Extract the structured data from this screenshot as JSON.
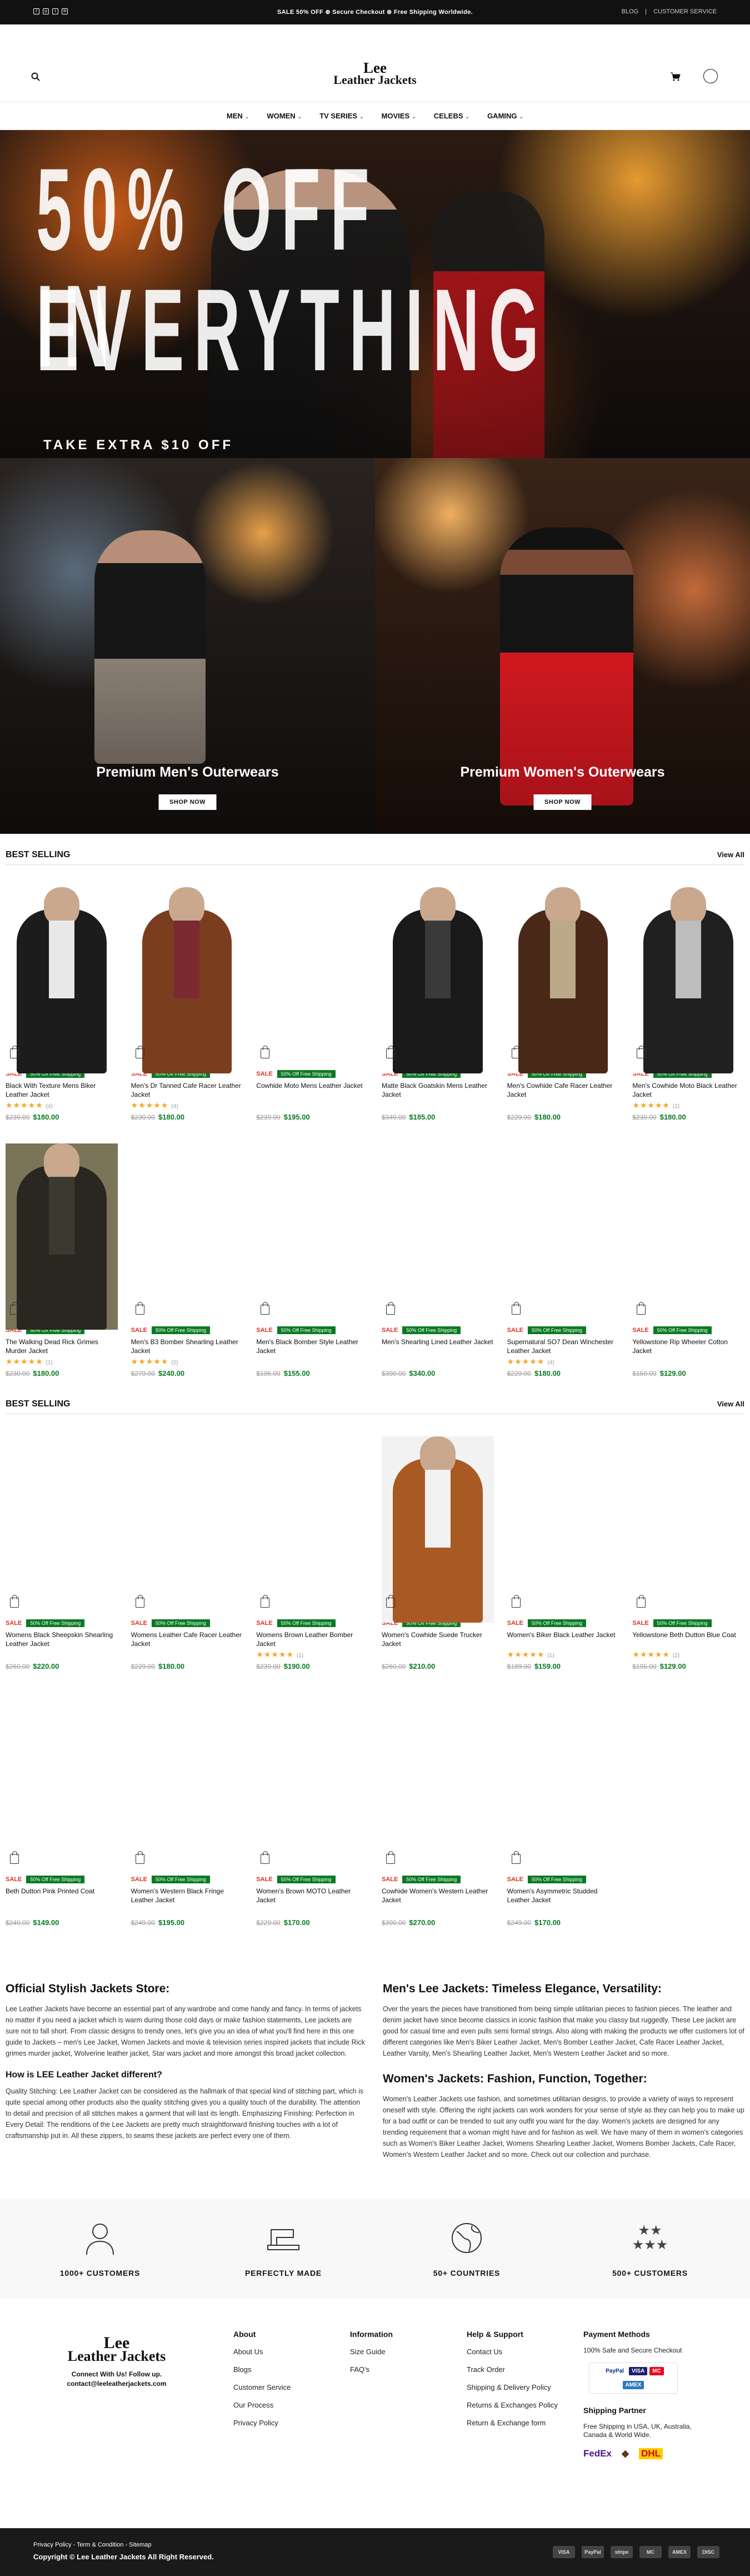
{
  "topbar": {
    "promo": "SALE 50% OFF ⊕ Secure Checkout ⊕ Free Shipping Worldwide.",
    "links": [
      "BLOG",
      "|",
      "CUSTOMER SERVICE"
    ]
  },
  "header": {
    "logo_line1": "Lee",
    "logo_line2": "Leather Jackets"
  },
  "nav": [
    "MEN",
    "WOMEN",
    "TV SERIES",
    "MOVIES",
    "CELEBS",
    "GAMING"
  ],
  "hero": {
    "line1": "50% OFF IN",
    "line2": "EVERYTHING",
    "sub": "TAKE EXTRA $10 OFF"
  },
  "promos": [
    {
      "title": "Premium Men's Outerwears",
      "button": "SHOP NOW"
    },
    {
      "title": "Premium Women's Outerwears",
      "button": "SHOP NOW"
    }
  ],
  "section1": {
    "title": "BEST SELLING",
    "view_all": "View All"
  },
  "section2": {
    "title": "BEST SELLING",
    "view_all": "View All"
  },
  "labels": {
    "sale": "SALE",
    "ship": "50% Off Free Shipping"
  },
  "products1": [
    {
      "name": "Black With Texture Mens Biker Leather Jacket",
      "stars": "★★★★★",
      "count": "(4)",
      "old": "$239.00",
      "new": "$180.00"
    },
    {
      "name": "Men's Dr Tanned Cafe Racer Leather Jacket",
      "stars": "★★★★★",
      "count": "(4)",
      "old": "$230.00",
      "new": "$180.00"
    },
    {
      "name": "Cowhide Moto Mens Leather Jacket",
      "stars": "",
      "count": "",
      "old": "$239.00",
      "new": "$195.00"
    },
    {
      "name": "Matte Black Goatskin Mens Leather Jacket",
      "stars": "",
      "count": "",
      "old": "$349.00",
      "new": "$185.00"
    },
    {
      "name": "Men's Cowhide Cafe Racer Leather Jacket",
      "stars": "",
      "count": "",
      "old": "$229.00",
      "new": "$180.00"
    },
    {
      "name": "Men's Cowhide Moto Black Leather Jacket",
      "stars": "★★★★★",
      "count": "(1)",
      "old": "$230.00",
      "new": "$180.00"
    },
    {
      "name": "The Walking Dead Rick Grimes Murder Jacket",
      "stars": "★★★★★",
      "count": "(1)",
      "old": "$230.00",
      "new": "$180.00"
    },
    {
      "name": "Men's B3 Bomber Shearling Leather Jacket",
      "stars": "★★★★★",
      "count": "(2)",
      "old": "$279.00",
      "new": "$240.00"
    },
    {
      "name": "Men's Black Bomber Style Leather Jacket",
      "stars": "",
      "count": "",
      "old": "$195.00",
      "new": "$155.00"
    },
    {
      "name": "Men's Shearling Lined Leather Jacket",
      "stars": "",
      "count": "",
      "old": "$390.00",
      "new": "$340.00"
    },
    {
      "name": "Supernatural SO7 Dean Winchester Leather Jacket",
      "stars": "★★★★★",
      "count": "(4)",
      "old": "$229.00",
      "new": "$180.00"
    },
    {
      "name": "Yellowstone Rip Wheeler Cotton Jacket",
      "stars": "",
      "count": "",
      "old": "$150.00",
      "new": "$129.00"
    }
  ],
  "products2": [
    {
      "name": "Womens Black Sheepskin Shearling Leather Jacket",
      "stars": "",
      "count": "",
      "old": "$260.00",
      "new": "$220.00"
    },
    {
      "name": "Womens Leather Cafe Racer Leather Jacket",
      "stars": "",
      "count": "",
      "old": "$229.00",
      "new": "$180.00"
    },
    {
      "name": "Womens Brown Leather Bomber Jacket",
      "stars": "★★★★★",
      "count": "(1)",
      "old": "$239.00",
      "new": "$190.00"
    },
    {
      "name": "Women's Cowhide Suede Trucker Jacket",
      "stars": "",
      "count": "",
      "old": "$260.00",
      "new": "$210.00"
    },
    {
      "name": "Women's Biker Black Leather Jacket",
      "stars": "★★★★★",
      "count": "(1)",
      "old": "$189.00",
      "new": "$159.00"
    },
    {
      "name": "Yellowstone Beth Dutton Blue Coat",
      "stars": "★★★★★",
      "count": "(2)",
      "old": "$195.00",
      "new": "$129.00"
    },
    {
      "name": "Beth Dutton Pink Printed Coat",
      "stars": "",
      "count": "",
      "old": "$240.00",
      "new": "$149.00"
    },
    {
      "name": "Women's Western Black Fringe Leather Jacket",
      "stars": "",
      "count": "",
      "old": "$249.00",
      "new": "$195.00"
    },
    {
      "name": "Women's Brown MOTO Leather Jacket",
      "stars": "",
      "count": "",
      "old": "$229.00",
      "new": "$170.00"
    },
    {
      "name": "Cowhide Women's Western Leather Jacket",
      "stars": "",
      "count": "",
      "old": "$390.00",
      "new": "$270.00"
    },
    {
      "name": "Women's Asymmetric Studded Leather Jacket",
      "stars": "",
      "count": "",
      "old": "$249.00",
      "new": "$170.00"
    }
  ],
  "seo": {
    "left_h": "Official Stylish Jackets Store:",
    "left_p": "Lee Leather Jackets have become an essential part of any wardrobe and come handy and fancy. In terms of jackets no matter if you need a jacket which is warm during those cold days or make fashion statements, Lee jackets are sure not to fall short. From classic designs to trendy ones, let's give you an idea of what you'll find here in this one guide to Jackets – men's Lee Jacket, Women Jackets and movie & television series inspired jackets that include Rick grimes murder jacket, Wolverine leather jacket, Star wars jacket and more amongst this broad jacket collection.",
    "left_h2": "How is LEE Leather Jacket different?",
    "left_p2": "Quality Stitching: Lee Leather Jacket can be considered as the hallmark of that special kind of stitching part, which is quite special among other products also the quality stitching gives you a quality touch of the durability. The attention to detail and precision of all stitches makes a garment that will last its length. Emphasizing Finishing: Perfection in Every Detail: The renditions of the Lee Jackets are pretty much straightforward finishing touches with a lot of craftsmanship put in. All these zippers, to seams these jackets are perfect every one of them.",
    "right_h": "Men's Lee Jackets: Timeless Elegance, Versatility:",
    "right_p": "Over the years the pieces have transitioned from being simple utilitarian pieces to fashion pieces. The leather and denim jacket have since become classics in iconic fashion that make you classy but ruggedly. These Lee jacket are good for casual time and even pulls semi formal strings. Also along with making the products we offer customers lot of different categories like Men's Biker Leather Jacket, Men's Bomber Leather Jacket, Cafe Racer Leather Jacket, Leather Varsity, Men's Shearling Leather Jacket, Men's Western Leather Jacket and so more.",
    "right_h2": "Women's Jackets: Fashion, Function, Together:",
    "right_p2": "Women's Leather Jackets use fashion, and sometimes utilitarian designs, to provide a variety of ways to represent oneself with style. Offering the right jackets can work wonders for your sense of style as they can help you to make up for a bad outfit or can be trended to suit any outfit you want for the day. Women's jackets are designed for any trending requirement that a woman might have and for fashion as well. We have many of them in women's categories such as Women's Biker Leather Jacket, Womens Shearling Leather Jacket, Womens Bomber Jackets, Cafe Racer, Women's Western Leather Jacket and so more. Check out our collection and purchase."
  },
  "features": [
    "1000+ CUSTOMERS",
    "PERFECTLY MADE",
    "50+ COUNTRIES",
    "500+ CUSTOMERS"
  ],
  "footer": {
    "logo_line1": "Lee",
    "logo_line2": "Leather Jackets",
    "connect": "Connect With Us! Follow up.",
    "email": "contact@leeleatherjackets.com",
    "about_h": "About",
    "about": [
      "About Us",
      "Blogs",
      "Customer Service",
      "Our Process",
      "Privacy Policy"
    ],
    "info_h": "Information",
    "info": [
      "Size Guide",
      "FAQ's"
    ],
    "help_h": "Help & Support",
    "help": [
      "Contact Us",
      "Track Order",
      "Shipping & Delivery Policy",
      "Returns & Exchanges Policy",
      "Return & Exchange form"
    ],
    "pay_h": "Payment Methods",
    "pay_p": "100% Safe and Secure Checkout",
    "ship_h": "Shipping Partner",
    "ship_p": "Free Shipping in USA, UK, Australia, Canada & World Wide."
  },
  "bottom": {
    "links": "Privacy Policy - Term & Condition - Sitemap",
    "copyright": "Copyright © Lee Leather Jackets All Right Reserved.",
    "cards": [
      "VISA",
      "PayPal",
      "stripe",
      "MC",
      "AMEX",
      "DISC"
    ]
  }
}
